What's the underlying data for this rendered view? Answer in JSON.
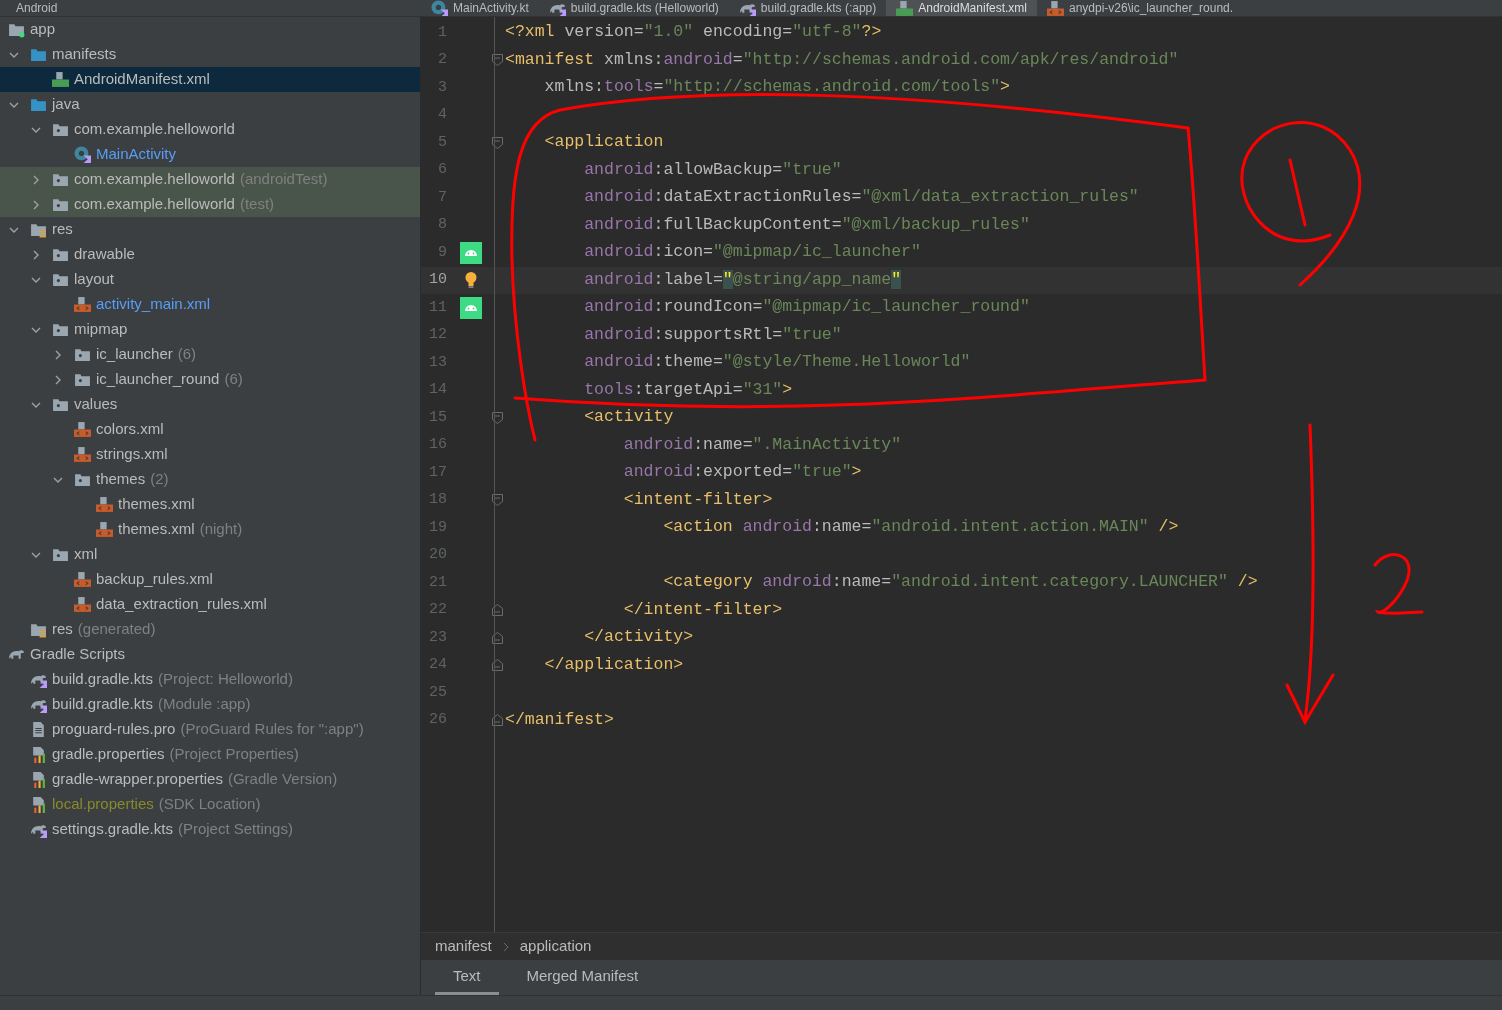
{
  "project_panel": {
    "view": "Android",
    "tree": [
      {
        "label": "app",
        "kind": "module",
        "selected": false,
        "children": [
          {
            "label": "manifests",
            "kind": "folder-blue",
            "expanded": true,
            "selected": false,
            "children": [
              {
                "label": "AndroidManifest.xml",
                "kind": "manifest",
                "selected": true
              }
            ]
          },
          {
            "label": "java",
            "kind": "folder-blue",
            "expanded": true,
            "selected": false,
            "children": [
              {
                "label": "com.example.helloworld",
                "kind": "package",
                "expanded": true,
                "selected": false,
                "test": false,
                "children": [
                  {
                    "label": "MainActivity",
                    "kind": "kotlin-class",
                    "color": "#589df6",
                    "selected": false
                  }
                ]
              },
              {
                "label": "com.example.helloworld",
                "suffix": "(androidTest)",
                "kind": "package",
                "expanded": false,
                "selected": false,
                "test": true
              },
              {
                "label": "com.example.helloworld",
                "suffix": "(test)",
                "kind": "package",
                "expanded": false,
                "selected": false,
                "test": true
              }
            ]
          },
          {
            "label": "res",
            "kind": "res-folder",
            "expanded": true,
            "selected": false,
            "children": [
              {
                "label": "drawable",
                "kind": "package",
                "expanded": false,
                "selected": false
              },
              {
                "label": "layout",
                "kind": "package",
                "expanded": true,
                "selected": false,
                "children": [
                  {
                    "label": "activity_main.xml",
                    "kind": "xml",
                    "color": "#589df6",
                    "selected": false
                  }
                ]
              },
              {
                "label": "mipmap",
                "kind": "package",
                "expanded": true,
                "selected": false,
                "children": [
                  {
                    "label": "ic_launcher",
                    "suffix": "(6)",
                    "kind": "package",
                    "expanded": false,
                    "selected": false
                  },
                  {
                    "label": "ic_launcher_round",
                    "suffix": "(6)",
                    "kind": "package",
                    "expanded": false,
                    "selected": false
                  }
                ]
              },
              {
                "label": "values",
                "kind": "package",
                "expanded": true,
                "selected": false,
                "children": [
                  {
                    "label": "colors.xml",
                    "kind": "xml",
                    "selected": false
                  },
                  {
                    "label": "strings.xml",
                    "kind": "xml",
                    "selected": false
                  },
                  {
                    "label": "themes",
                    "suffix": "(2)",
                    "kind": "package",
                    "expanded": true,
                    "selected": false,
                    "children": [
                      {
                        "label": "themes.xml",
                        "kind": "xml",
                        "selected": false
                      },
                      {
                        "label": "themes.xml",
                        "suffix": "(night)",
                        "kind": "xml",
                        "selected": false
                      }
                    ]
                  }
                ]
              },
              {
                "label": "xml",
                "kind": "package",
                "expanded": true,
                "selected": false,
                "children": [
                  {
                    "label": "backup_rules.xml",
                    "kind": "xml",
                    "selected": false
                  },
                  {
                    "label": "data_extraction_rules.xml",
                    "kind": "xml",
                    "selected": false
                  }
                ]
              }
            ]
          },
          {
            "label": "res",
            "suffix": "(generated)",
            "kind": "res-folder",
            "selected": false
          }
        ]
      },
      {
        "label": "Gradle Scripts",
        "kind": "gradle",
        "selected": false,
        "children": [
          {
            "label": "build.gradle.kts",
            "suffix": "(Project: Helloworld)",
            "kind": "gradle-kts",
            "selected": false
          },
          {
            "label": "build.gradle.kts",
            "suffix": "(Module :app)",
            "kind": "gradle-kts",
            "selected": false
          },
          {
            "label": "proguard-rules.pro",
            "suffix": "(ProGuard Rules for \":app\")",
            "kind": "text-file",
            "selected": false
          },
          {
            "label": "gradle.properties",
            "suffix": "(Project Properties)",
            "kind": "properties",
            "selected": false
          },
          {
            "label": "gradle-wrapper.properties",
            "suffix": "(Gradle Version)",
            "kind": "properties",
            "selected": false
          },
          {
            "label": "local.properties",
            "suffix": "(SDK Location)",
            "kind": "properties",
            "color": "#8a8a2a",
            "selected": false
          },
          {
            "label": "settings.gradle.kts",
            "suffix": "(Project Settings)",
            "kind": "gradle-kts",
            "selected": false
          }
        ]
      }
    ]
  },
  "editor_tabs": [
    {
      "label": "MainActivity.kt",
      "kind": "kotlin-class",
      "selected": false
    },
    {
      "label": "build.gradle.kts (Helloworld)",
      "kind": "gradle-kts",
      "selected": false
    },
    {
      "label": "build.gradle.kts (:app)",
      "kind": "gradle-kts",
      "selected": false
    },
    {
      "label": "AndroidManifest.xml",
      "kind": "manifest",
      "selected": true
    },
    {
      "label": "anydpi-v26\\ic_launcher_round.",
      "kind": "xml",
      "selected": false
    }
  ],
  "code_lines": [
    {
      "number": "1",
      "current": false,
      "tokens": [
        {
          "kind": "tag",
          "text": "<?xml "
        },
        {
          "kind": "attr",
          "text": "version="
        },
        {
          "kind": "value",
          "text": "\"1.0\" "
        },
        {
          "kind": "attr",
          "text": "encoding="
        },
        {
          "kind": "value",
          "text": "\"utf-8\""
        },
        {
          "kind": "tag",
          "text": "?>"
        }
      ]
    },
    {
      "number": "2",
      "current": false,
      "fold": {
        "kind": "open"
      },
      "tokens": [
        {
          "kind": "tag",
          "text": "<manifest "
        },
        {
          "kind": "attr",
          "text": "xmlns:"
        },
        {
          "kind": "ns",
          "text": "android"
        },
        {
          "kind": "attr",
          "text": "="
        },
        {
          "kind": "value",
          "text": "\"http://schemas.android.com/apk/res/android\""
        }
      ]
    },
    {
      "number": "3",
      "current": false,
      "tokens": [
        {
          "kind": "attr",
          "text": "    xmlns:"
        },
        {
          "kind": "ns",
          "text": "tools"
        },
        {
          "kind": "attr",
          "text": "="
        },
        {
          "kind": "value",
          "text": "\"http://schemas.android.com/tools\""
        },
        {
          "kind": "tag",
          "text": ">"
        }
      ]
    },
    {
      "number": "4",
      "current": false
    },
    {
      "number": "5",
      "current": false,
      "fold": {
        "kind": "open"
      },
      "tokens": [
        {
          "kind": "tag",
          "text": "    <application"
        }
      ]
    },
    {
      "number": "6",
      "current": false,
      "tokens": [
        {
          "kind": "ns",
          "text": "        android"
        },
        {
          "kind": "attr",
          "text": ":allowBackup="
        },
        {
          "kind": "value",
          "text": "\"true\""
        }
      ]
    },
    {
      "number": "7",
      "current": false,
      "tokens": [
        {
          "kind": "ns",
          "text": "        android"
        },
        {
          "kind": "attr",
          "text": ":dataExtractionRules="
        },
        {
          "kind": "value",
          "text": "\"@xml/data_extraction_rules\""
        }
      ]
    },
    {
      "number": "8",
      "current": false,
      "tokens": [
        {
          "kind": "ns",
          "text": "        android"
        },
        {
          "kind": "attr",
          "text": ":fullBackupContent="
        },
        {
          "kind": "value",
          "text": "\"@xml/backup_rules\""
        }
      ]
    },
    {
      "number": "9",
      "current": false,
      "gutter": {
        "kind": "android"
      },
      "tokens": [
        {
          "kind": "ns",
          "text": "        android"
        },
        {
          "kind": "attr",
          "text": ":icon="
        },
        {
          "kind": "value",
          "text": "\"@mipmap/ic_launcher\""
        }
      ]
    },
    {
      "number": "10",
      "current": true,
      "gutter": {
        "kind": "bulb"
      },
      "tokens": [
        {
          "kind": "ns",
          "text": "        android"
        },
        {
          "kind": "attr",
          "text": ":label="
        },
        {
          "kind": "match",
          "text": "\""
        },
        {
          "kind": "value",
          "text": "@string/app_name"
        },
        {
          "kind": "match",
          "text": "\""
        }
      ]
    },
    {
      "number": "11",
      "current": false,
      "gutter": {
        "kind": "android"
      },
      "tokens": [
        {
          "kind": "ns",
          "text": "        android"
        },
        {
          "kind": "attr",
          "text": ":roundIcon="
        },
        {
          "kind": "value",
          "text": "\"@mipmap/ic_launcher_round\""
        }
      ]
    },
    {
      "number": "12",
      "current": false,
      "tokens": [
        {
          "kind": "ns",
          "text": "        android"
        },
        {
          "kind": "attr",
          "text": ":supportsRtl="
        },
        {
          "kind": "value",
          "text": "\"true\""
        }
      ]
    },
    {
      "number": "13",
      "current": false,
      "tokens": [
        {
          "kind": "ns",
          "text": "        android"
        },
        {
          "kind": "attr",
          "text": ":theme="
        },
        {
          "kind": "value",
          "text": "\"@style/Theme.Helloworld\""
        }
      ]
    },
    {
      "number": "14",
      "current": false,
      "tokens": [
        {
          "kind": "ns",
          "text": "        tools"
        },
        {
          "kind": "attr",
          "text": ":targetApi="
        },
        {
          "kind": "value",
          "text": "\"31\""
        },
        {
          "kind": "tag",
          "text": ">"
        }
      ]
    },
    {
      "number": "15",
      "current": false,
      "fold": {
        "kind": "open"
      },
      "tokens": [
        {
          "kind": "tag",
          "text": "        <activity"
        }
      ]
    },
    {
      "number": "16",
      "current": false,
      "tokens": [
        {
          "kind": "ns",
          "text": "            android"
        },
        {
          "kind": "attr",
          "text": ":name="
        },
        {
          "kind": "value",
          "text": "\".MainActivity\""
        }
      ]
    },
    {
      "number": "17",
      "current": false,
      "tokens": [
        {
          "kind": "ns",
          "text": "            android"
        },
        {
          "kind": "attr",
          "text": ":exported="
        },
        {
          "kind": "value",
          "text": "\"true\""
        },
        {
          "kind": "tag",
          "text": ">"
        }
      ]
    },
    {
      "number": "18",
      "current": false,
      "fold": {
        "kind": "open"
      },
      "tokens": [
        {
          "kind": "tag",
          "text": "            <intent-filter>"
        }
      ]
    },
    {
      "number": "19",
      "current": false,
      "tokens": [
        {
          "kind": "tag",
          "text": "                <action "
        },
        {
          "kind": "ns",
          "text": "android"
        },
        {
          "kind": "attr",
          "text": ":name="
        },
        {
          "kind": "value",
          "text": "\"android.intent.action.MAIN\" "
        },
        {
          "kind": "tag",
          "text": "/>"
        }
      ]
    },
    {
      "number": "20",
      "current": false
    },
    {
      "number": "21",
      "current": false,
      "tokens": [
        {
          "kind": "tag",
          "text": "                <category "
        },
        {
          "kind": "ns",
          "text": "android"
        },
        {
          "kind": "attr",
          "text": ":name="
        },
        {
          "kind": "value",
          "text": "\"android.intent.category.LAUNCHER\" "
        },
        {
          "kind": "tag",
          "text": "/>"
        }
      ]
    },
    {
      "number": "22",
      "current": false,
      "fold": {
        "kind": "close"
      },
      "tokens": [
        {
          "kind": "tag",
          "text": "            </intent-filter>"
        }
      ]
    },
    {
      "number": "23",
      "current": false,
      "fold": {
        "kind": "close"
      },
      "tokens": [
        {
          "kind": "tag",
          "text": "        </activity>"
        }
      ]
    },
    {
      "number": "24",
      "current": false,
      "fold": {
        "kind": "close"
      },
      "tokens": [
        {
          "kind": "tag",
          "text": "    </application>"
        }
      ]
    },
    {
      "number": "25",
      "current": false
    },
    {
      "number": "26",
      "current": false,
      "fold": {
        "kind": "close"
      },
      "tokens": [
        {
          "kind": "tag",
          "text": "</manifest>"
        }
      ]
    }
  ],
  "breadcrumb": [
    "manifest",
    "application"
  ],
  "bottom_tabs": [
    {
      "label": "Text",
      "selected": true
    },
    {
      "label": "Merged Manifest",
      "selected": false
    }
  ]
}
